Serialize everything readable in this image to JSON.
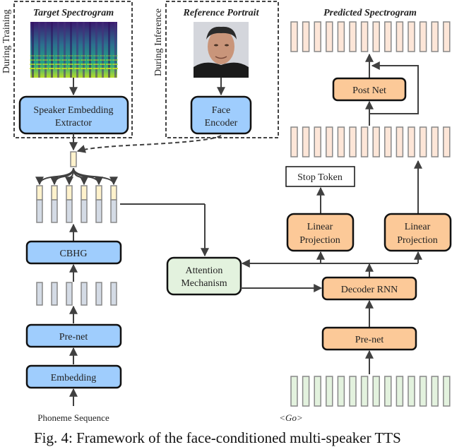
{
  "figure": {
    "caption": "Fig. 4: Framework of the face-conditioned multi-speaker TTS",
    "colors": {
      "blue_box": "#9fcdfd",
      "orange_box": "#fcc998",
      "green_box": "#e3f2de",
      "beige_cell": "#fff2cc",
      "gray_cell": "#d4dbe5",
      "pink_cell": "#fde6d8",
      "green_cell": "#e3f2de",
      "line": "#404040"
    }
  },
  "training_panel": {
    "side_label": "During Training",
    "title": "Target Spectrogram",
    "block": [
      "Speaker Embedding",
      "Extractor"
    ]
  },
  "inference_panel": {
    "side_label": "During Inference",
    "title": "Reference Portrait",
    "block": [
      "Face",
      "Encoder"
    ]
  },
  "encoder": {
    "cbhg": "CBHG",
    "prenet": "Pre-net",
    "embedding": "Embedding",
    "input_label": "Phoneme Sequence",
    "cell_count": 6
  },
  "attention": {
    "label": [
      "Attention",
      "Mechanism"
    ]
  },
  "decoder": {
    "title": "Predicted Spectrogram",
    "postnet": "Post Net",
    "stop_token": "Stop Token",
    "linear_projection_left": [
      "Linear",
      "Projection"
    ],
    "linear_projection_right": [
      "Linear",
      "Projection"
    ],
    "decoder_rnn": "Decoder RNN",
    "prenet": "Pre-net",
    "go_label": "<Go>",
    "frame_count": 14
  }
}
